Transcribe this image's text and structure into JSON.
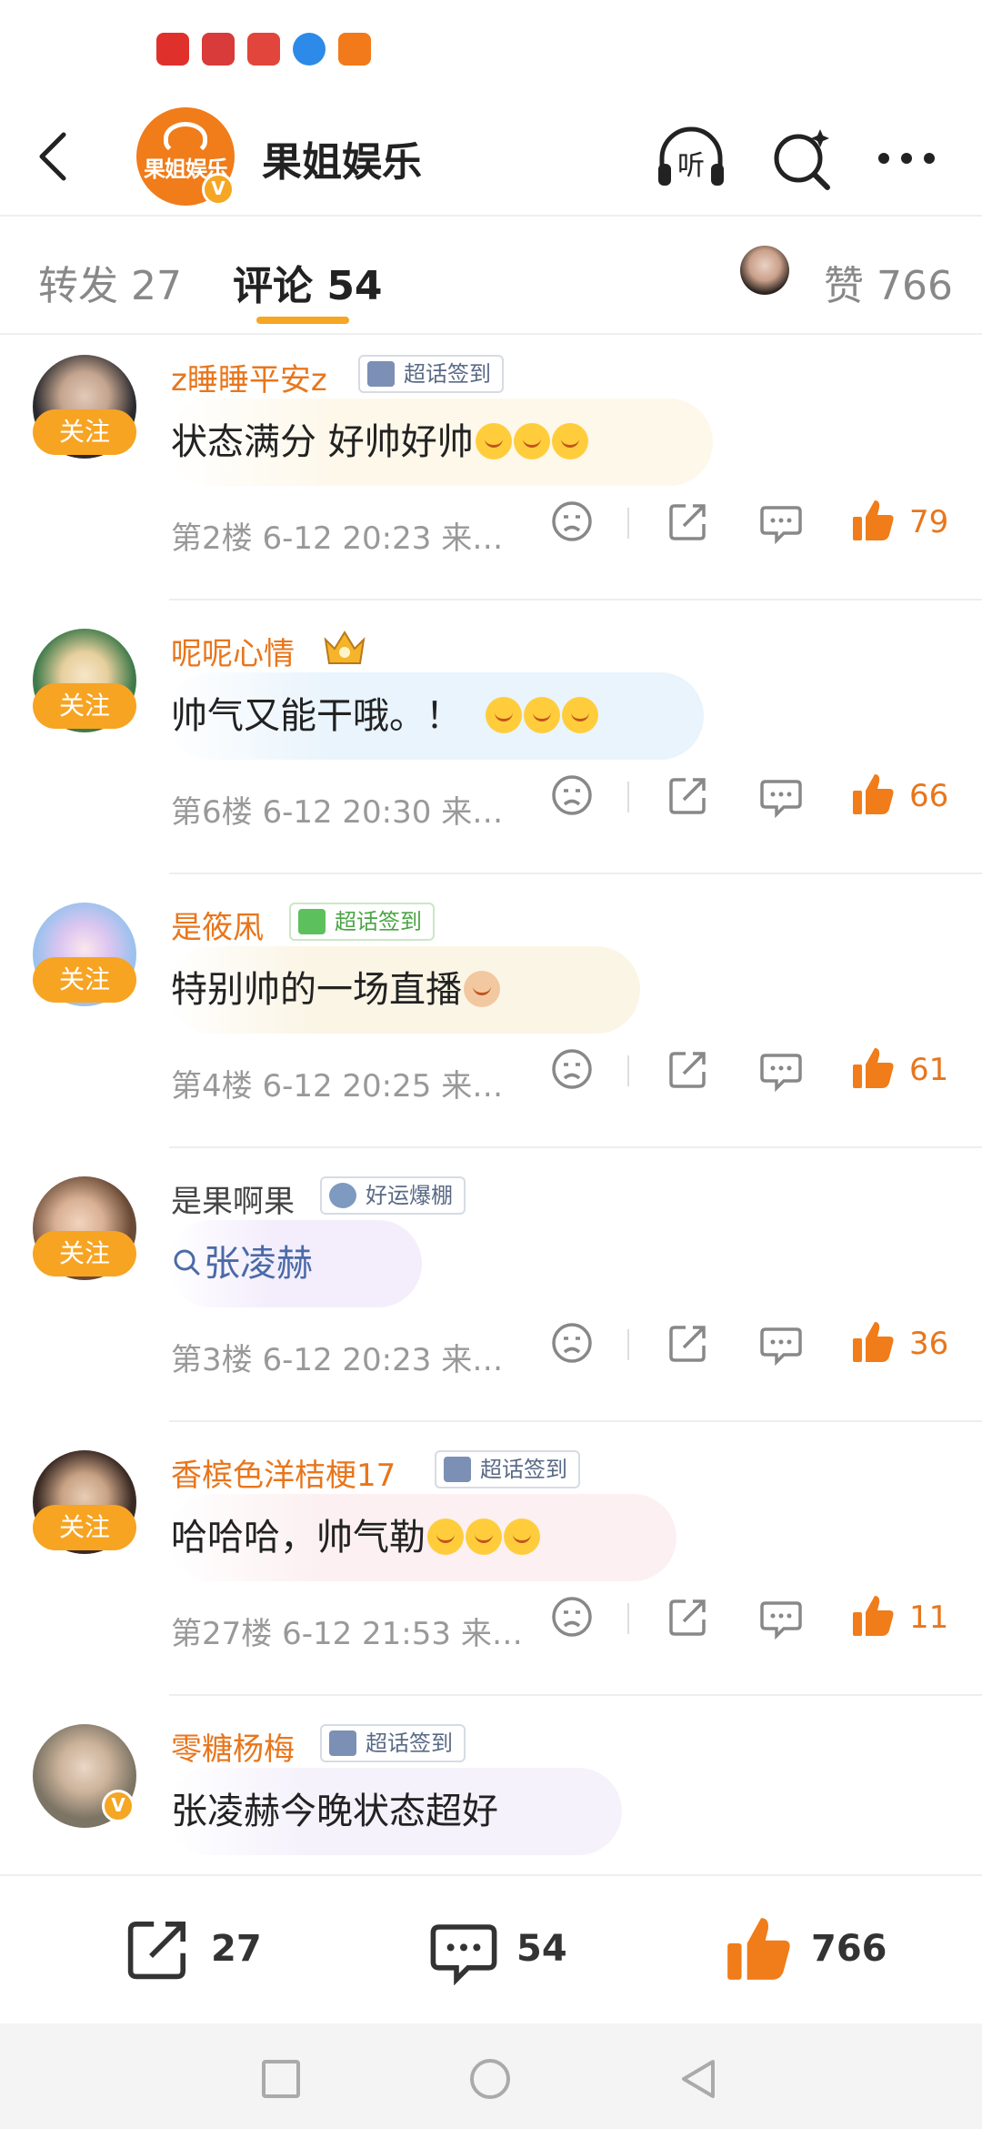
{
  "status_bar": {
    "apps": [
      {
        "icon": "xiaohongshu-app-icon",
        "color": "#e0302c"
      },
      {
        "icon": "huawei-app-icon",
        "color": "#d93a3a"
      },
      {
        "icon": "reader-app-icon",
        "color": "#e2453b"
      },
      {
        "icon": "browser-app-icon",
        "color": "#2d8ae8"
      },
      {
        "icon": "taobao-app-icon",
        "color": "#f27a1a"
      }
    ]
  },
  "header": {
    "logo_text": "果姐娱乐",
    "account_name": "果姐娱乐",
    "verify_mark": "V",
    "listen_label": "听"
  },
  "tabs": {
    "repost": "转发 27",
    "comments": "评论 54",
    "likes": "赞 766"
  },
  "comments": [
    {
      "name": "z睡睡平安z",
      "name_style": "orange",
      "badge": "超话签到",
      "badge_style": "blue",
      "follow": "关注",
      "text": "状态满分 好帅好帅",
      "emoji_count": 3,
      "bubble_bg": "#fdf8ea",
      "meta": "第2楼 6-12 20:23 来…",
      "likes": "79",
      "avatar_bg": "#2a2a2e"
    },
    {
      "name": "呢呢心情",
      "name_style": "orange",
      "badge": "",
      "crown": true,
      "follow": "关注",
      "text": "帅气又能干哦。！",
      "emoji_count": 3,
      "bubble_bg": "#e9f4fc",
      "meta": "第6楼 6-12 20:30 来…",
      "likes": "66",
      "avatar_bg": "#3f7a4a"
    },
    {
      "name": "是筱凩",
      "name_style": "orange",
      "badge": "超话签到",
      "badge_style": "green",
      "follow": "关注",
      "text": "特别帅的一场直播",
      "emoji_count": 1,
      "bubble_bg": "#fbf5e6",
      "meta": "第4楼 6-12 20:25 来…",
      "likes": "61",
      "avatar_bg": "#bcd3f0"
    },
    {
      "name": "是果啊果",
      "name_style": "gray",
      "badge": "好运爆棚",
      "badge_style": "blue",
      "follow": "关注",
      "text": "张凌赫",
      "search_link": true,
      "emoji_count": 0,
      "bubble_bg": "#f4eefc",
      "meta": "第3楼 6-12 20:23 来…",
      "likes": "36",
      "avatar_bg": "#8a5d43"
    },
    {
      "name": "香槟色洋桔梗17",
      "name_style": "orange",
      "badge": "超话签到",
      "badge_style": "blue",
      "follow": "关注",
      "text": "哈哈哈，帅气勒",
      "emoji_count": 3,
      "bubble_bg": "#fcf0f2",
      "meta": "第27楼 6-12 21:53 来…",
      "likes": "11",
      "avatar_bg": "#5a3a30"
    },
    {
      "name": "零糖杨梅",
      "name_style": "orange",
      "badge": "超话签到",
      "badge_style": "blue",
      "follow": "",
      "text": "张凌赫今晚状态超好",
      "emoji_count": 0,
      "bubble_bg": "#f5f2fb",
      "meta": "",
      "likes": "",
      "avatar_bg": "#8c8575"
    }
  ],
  "action_bar": {
    "reposts": "27",
    "comments": "54",
    "likes": "766"
  },
  "colors": {
    "accent": "#f5a623",
    "name_orange": "#e8761c",
    "like_orange": "#f07c1a"
  }
}
